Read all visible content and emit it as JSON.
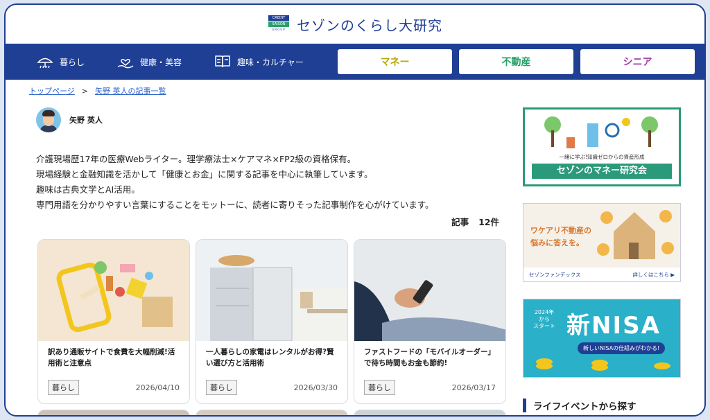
{
  "site": {
    "logo_line1": "CREDIT",
    "logo_line2": "SAISON",
    "logo_line3": "GROUP",
    "title": "セゾンのくらし大研究"
  },
  "nav": {
    "items": [
      {
        "label": "暮らし",
        "icon": "umbrella-icon"
      },
      {
        "label": "健康・美容",
        "icon": "hand-heart-icon"
      },
      {
        "label": "趣味・カルチャー",
        "icon": "book-icon"
      }
    ],
    "buttons": [
      {
        "label": "マネー",
        "color": "#b9a800"
      },
      {
        "label": "不動産",
        "color": "#2aa06a"
      },
      {
        "label": "シニア",
        "color": "#a23aa6"
      }
    ]
  },
  "breadcrumb": {
    "home": "トップページ",
    "separator": ">",
    "current": "矢野 英人の記事一覧"
  },
  "author": {
    "name": "矢野 英人",
    "bio": [
      "介護現場歴17年の医療Webライター。理学療法士×ケアマネ×FP2級の資格保有。",
      "現場経験と金融知識を活かして「健康とお金」に関する記事を中心に執筆しています。",
      "趣味は古典文学とAI活用。",
      "専門用語を分かりやすい言葉にすることをモットーに、読者に寄りそった記事制作を心がけています。"
    ],
    "count_label": "記事",
    "count_value": "12件"
  },
  "articles": [
    {
      "title": "訳あり通販サイトで食費を大幅削減!活用術と注意点",
      "tag": "暮らし",
      "date": "2026/04/10"
    },
    {
      "title": "一人暮らしの家電はレンタルがお得?賢い選び方と活用術",
      "tag": "暮らし",
      "date": "2026/03/30"
    },
    {
      "title": "ファストフードの「モバイルオーダー」で待ち時間もお金も節約!",
      "tag": "暮らし",
      "date": "2026/03/17"
    }
  ],
  "sidebar": {
    "banner1": {
      "sub": "一緒に学ぶ!知識ゼロからの資産形成",
      "label": "セゾンのマネー研究会"
    },
    "banner2": {
      "text1": "ワケアリ不動産の",
      "text2": "悩みに答えを。",
      "brand": "セゾンファンデックス",
      "link": "詳しくはこちら ▶"
    },
    "banner3": {
      "year1": "2024年",
      "year2": "から",
      "year3": "スタート",
      "big": "新NISA",
      "pill": "新しいNISAの仕組みがわかる!"
    },
    "section_title": "ライフイベントから探す"
  },
  "colors": {
    "brand": "#1f3f95",
    "accent_green": "#2aa06a"
  }
}
